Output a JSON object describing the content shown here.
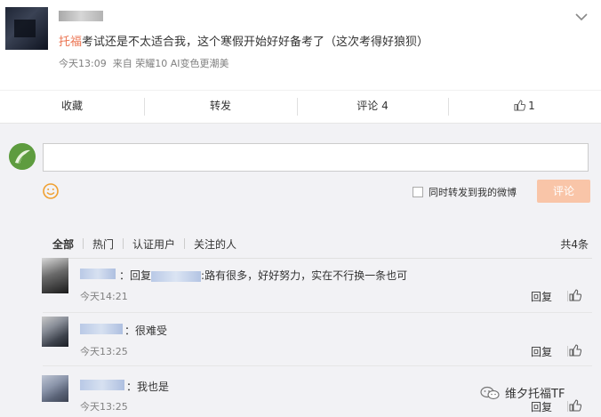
{
  "post": {
    "tag": "托福",
    "text": "考试还是不太适合我，这个寒假开始好好备考了（这次考得好狼狈）",
    "time": "今天13:09",
    "source": "来自 荣耀10 AI变色更潮美"
  },
  "actions": {
    "favorite": "收藏",
    "repost": "转发",
    "comment": "评论 4",
    "like": "1"
  },
  "composer": {
    "forward_label": "同时转发到我的微博",
    "submit_label": "评论"
  },
  "filters": {
    "tabs": [
      "全部",
      "热门",
      "认证用户",
      "关注的人"
    ],
    "count": "共4条"
  },
  "comments": [
    {
      "prefix": "：",
      "reply_word": "回复",
      "text": ":路有很多，好好努力，实在不行换一条也可",
      "time": "今天14:21",
      "reply": "回复"
    },
    {
      "prefix": "：",
      "text": "很难受",
      "time": "今天13:25",
      "reply": "回复"
    },
    {
      "prefix": "：",
      "text": "我也是",
      "time": "今天13:25",
      "reply": "回复"
    }
  ],
  "watermark": "维夕托福TF",
  "colors": {
    "accent": "#eb7350",
    "button_disabled": "#f9c5a8",
    "page_bg": "#f2f2f5"
  }
}
